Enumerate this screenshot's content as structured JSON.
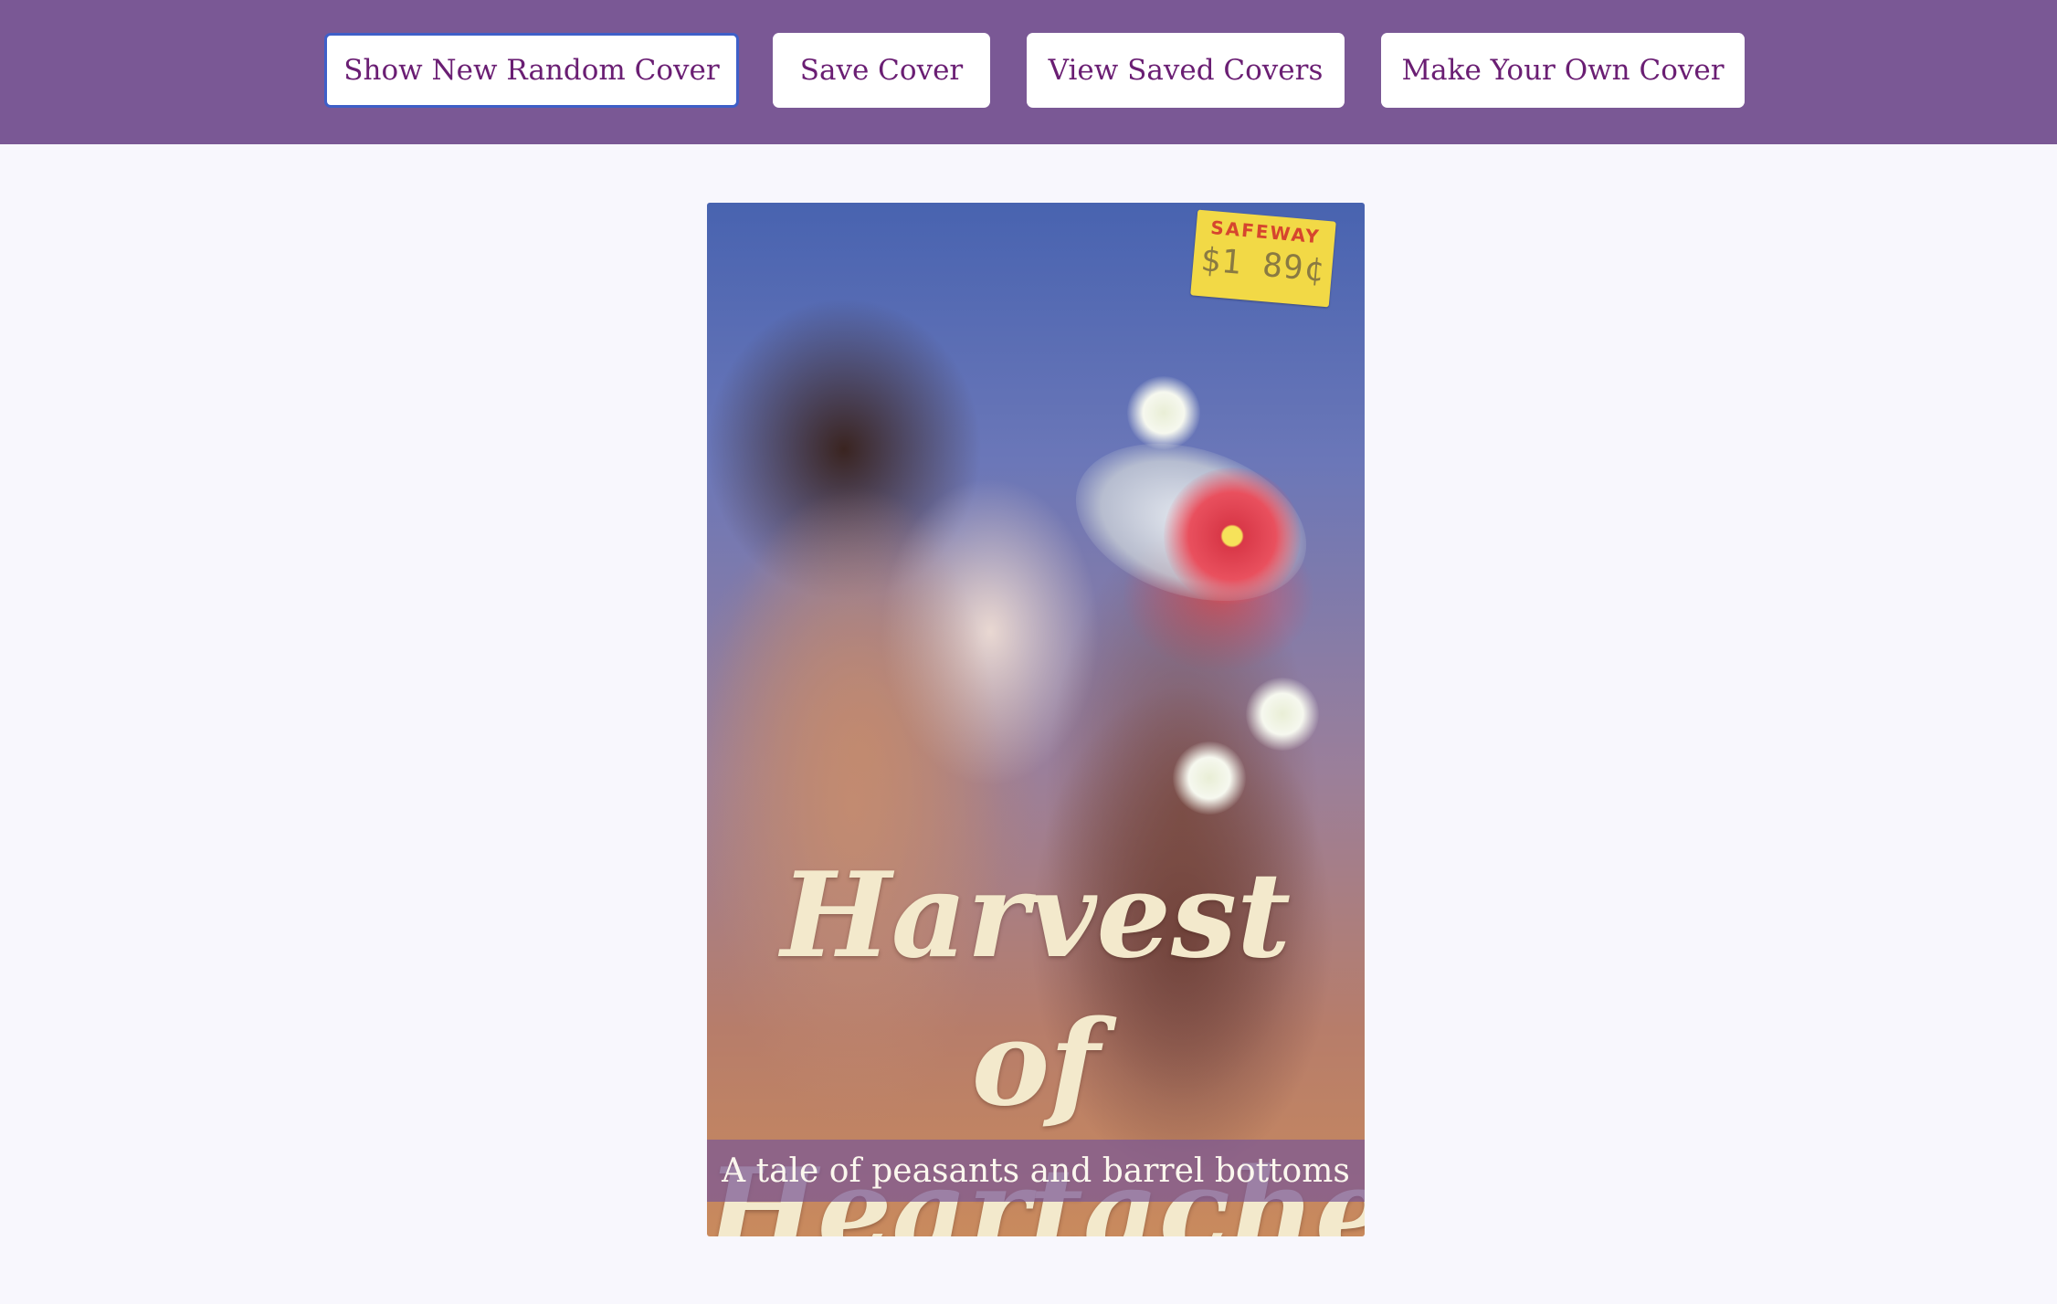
{
  "toolbar": {
    "random_label": "Show New Random Cover",
    "save_label": "Save Cover",
    "view_label": "View Saved Covers",
    "make_label": "Make Your Own Cover"
  },
  "cover": {
    "title_line1": "Harvest of",
    "title_line2": "Heartache",
    "tagline": "A tale of peasants and barrel bottoms",
    "price_tag": {
      "store": "SAFEWAY",
      "amount": "$1 89¢"
    }
  },
  "colors": {
    "header_bg": "#7a5895",
    "button_text": "#6a1e73",
    "page_bg": "#f8f7fd",
    "title_text": "#f3e9cc",
    "focus_ring": "#3e5fc8"
  }
}
